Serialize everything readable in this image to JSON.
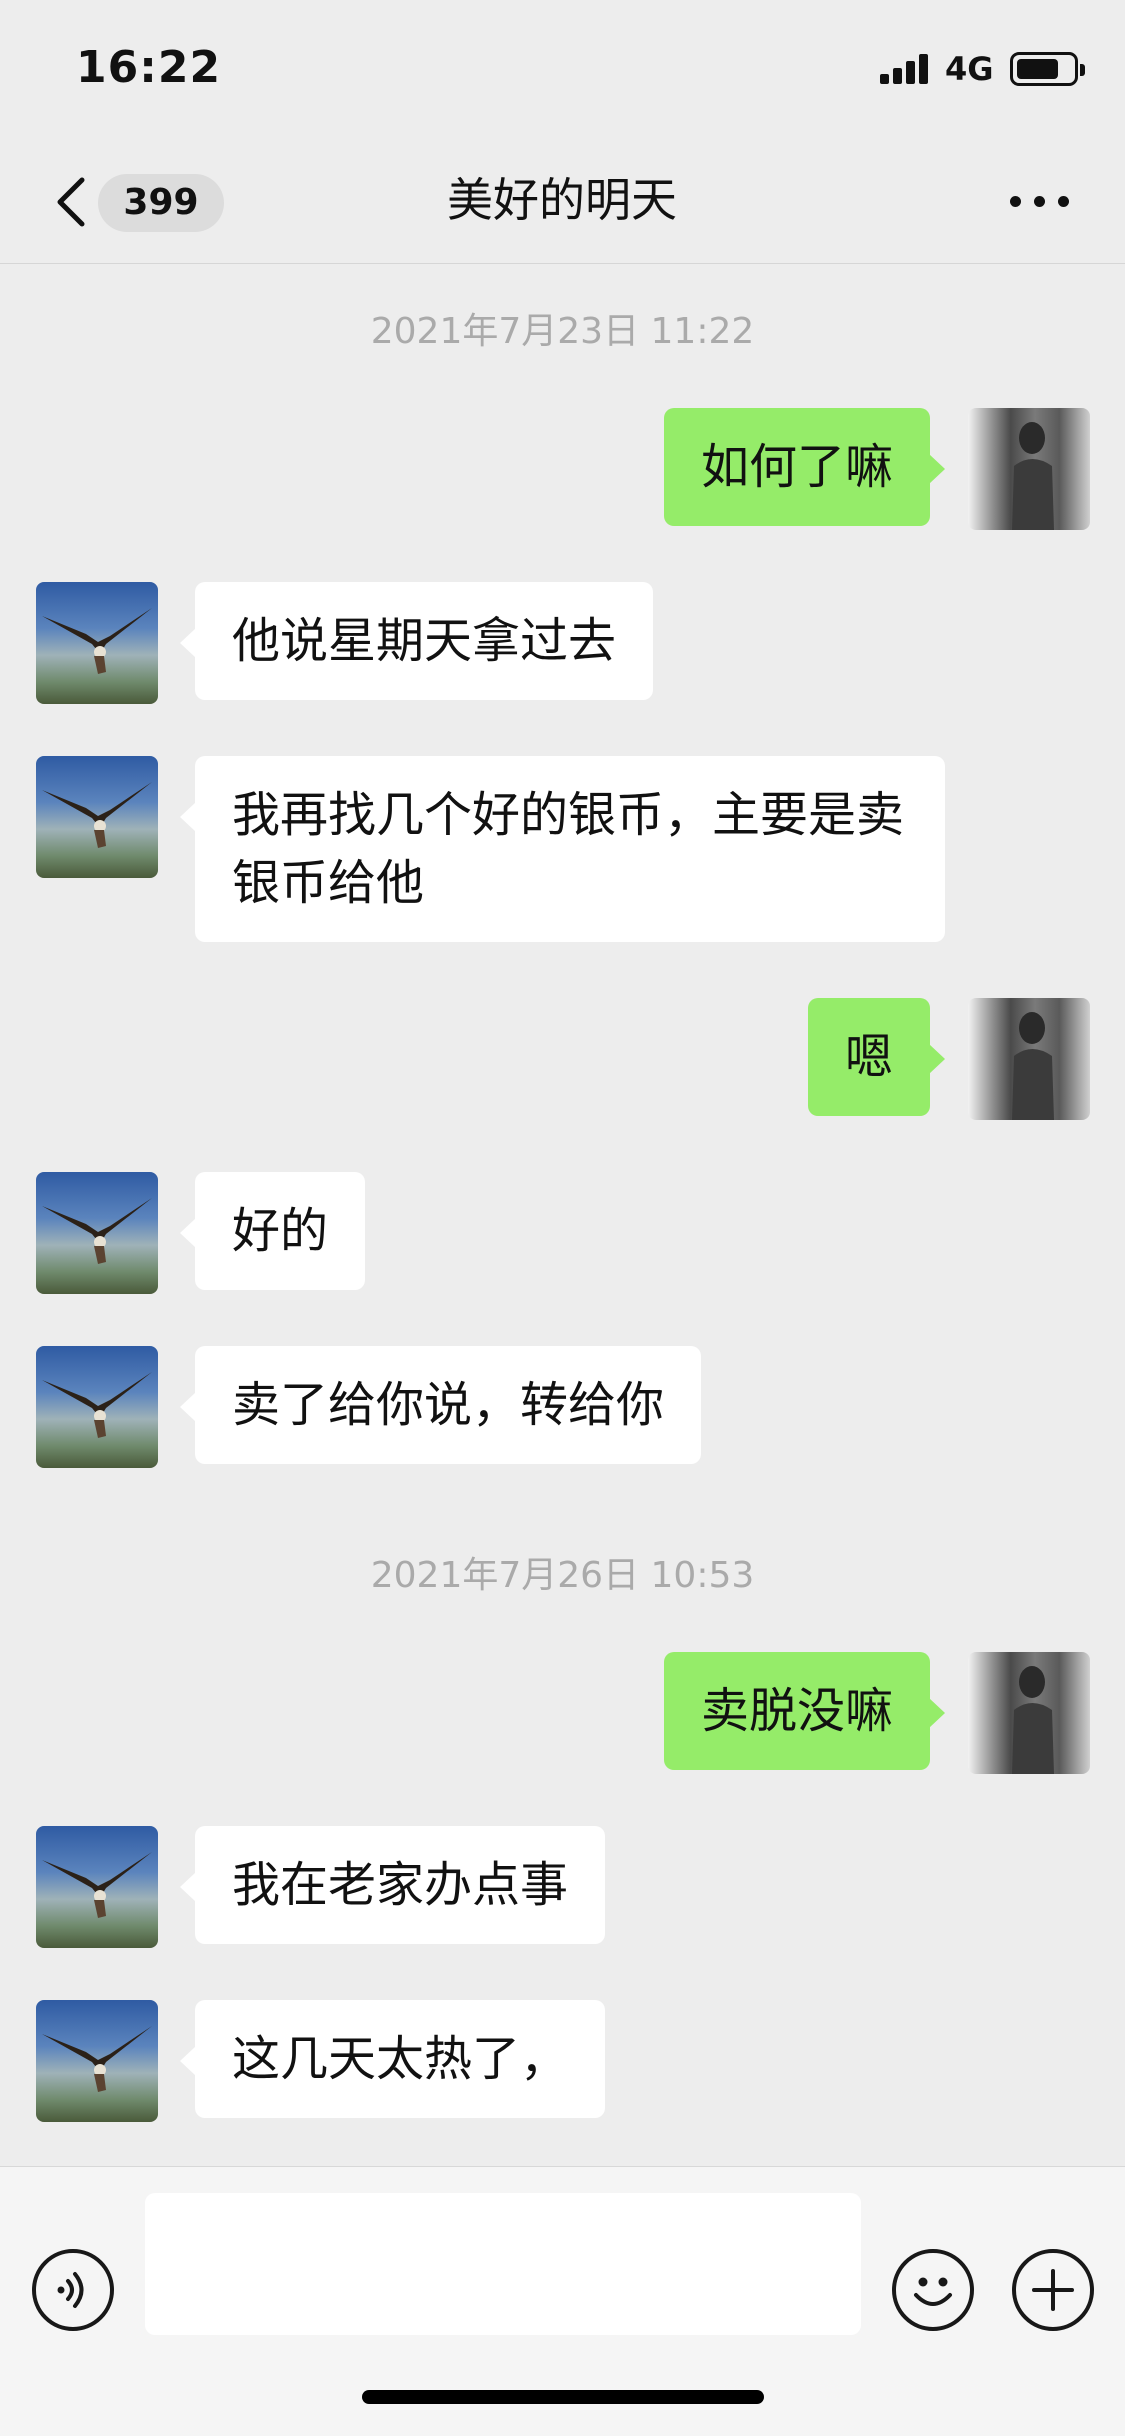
{
  "status_bar": {
    "time": "16:22",
    "network": "4G",
    "battery_level": 0.75
  },
  "nav": {
    "back_icon": "chevron-left-icon",
    "unread_count": "399",
    "title": "美好的明天",
    "more_icon": "ellipsis-icon"
  },
  "messages": [
    {
      "type": "timestamp",
      "text": "2021年7月23日 11:22"
    },
    {
      "type": "outgoing",
      "text": "如何了嘛"
    },
    {
      "type": "incoming",
      "text": "他说星期天拿过去"
    },
    {
      "type": "incoming",
      "text": "我再找几个好的银币，主要是卖银币给他"
    },
    {
      "type": "outgoing",
      "text": "嗯"
    },
    {
      "type": "incoming",
      "text": "好的"
    },
    {
      "type": "incoming",
      "text": "卖了给你说，转给你"
    },
    {
      "type": "timestamp",
      "text": "2021年7月26日 10:53"
    },
    {
      "type": "outgoing",
      "text": "卖脱没嘛"
    },
    {
      "type": "incoming",
      "text": "我在老家办点事"
    },
    {
      "type": "incoming",
      "text": "这几天太热了，"
    }
  ],
  "input_bar": {
    "voice_icon": "voice-icon",
    "message_value": "",
    "emoji_icon": "emoji-icon",
    "plus_icon": "plus-icon"
  },
  "colors": {
    "background": "#ededed",
    "outgoing_bubble": "#95ec69",
    "incoming_bubble": "#ffffff",
    "timestamp_text": "#aaaaaa"
  }
}
